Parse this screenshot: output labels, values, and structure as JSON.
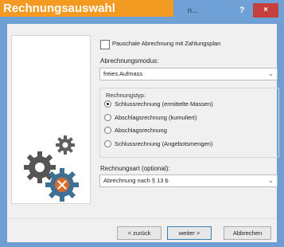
{
  "banner": {
    "text": "Rechnungsauswahl"
  },
  "window": {
    "title_fragment": "n...",
    "help_label": "?",
    "close_label": "×"
  },
  "form": {
    "pauschal_checkbox": {
      "label": "Pauschale Abrechnung mit Zahlungsplan",
      "checked": false
    },
    "abrechnungsmodus": {
      "label": "Abrechnungsmodus:",
      "value": "freies Aufmass"
    },
    "rechnungstyp": {
      "title": "Rechnungstyp:",
      "selected_index": 0,
      "options": [
        "Schlussrechnung (ermittelte Massen)",
        "Abschlagsrechnung (kumuliert)",
        "Abschlagsrechnung",
        "Schlussrechnung (Angebotsmengen)"
      ]
    },
    "rechnungsart": {
      "label": "Rechnungsart (optional):",
      "value": "Abrechnung nach § 13 b"
    }
  },
  "buttons": {
    "back": "< zurück",
    "next": "weiter >",
    "cancel": "Abbrechen"
  },
  "icons": {
    "chevron": "chevron-down-icon",
    "illustration": "gears-icon"
  }
}
